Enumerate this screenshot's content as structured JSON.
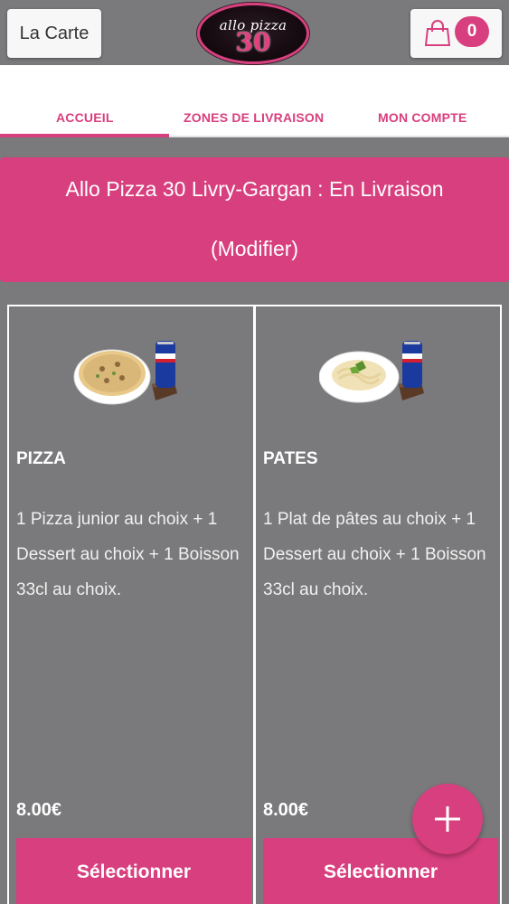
{
  "header": {
    "menu_label": "La Carte",
    "logo": {
      "line1": "allo pizza",
      "line2": "30"
    },
    "cart_count": "0"
  },
  "tabs": [
    {
      "label": "ACCUEIL",
      "active": true
    },
    {
      "label": "ZONES DE LIVRAISON",
      "active": false
    },
    {
      "label": "MON COMPTE",
      "active": false
    }
  ],
  "store": {
    "name": "Allo Pizza 30 Livry-Gargan : En Livraison",
    "modify_label": "(Modifier)"
  },
  "menus": [
    {
      "title": "PIZZA",
      "description": "1 Pizza junior au choix  + 1 Dessert au choix  + 1 Boisson 33cl au choix.",
      "price": "8.00€",
      "select_label": "Sélectionner",
      "image_icon": "pizza-menu-image"
    },
    {
      "title": "PATES",
      "description": "1 Plat de pâtes au choix  + 1 Dessert au choix  + 1 Boisson 33cl au choix.",
      "price": "8.00€",
      "select_label": "Sélectionner",
      "image_icon": "pasta-menu-image"
    }
  ],
  "colors": {
    "accent": "#d83f7e",
    "background": "#7a797b",
    "surface": "#f7f7f7"
  }
}
